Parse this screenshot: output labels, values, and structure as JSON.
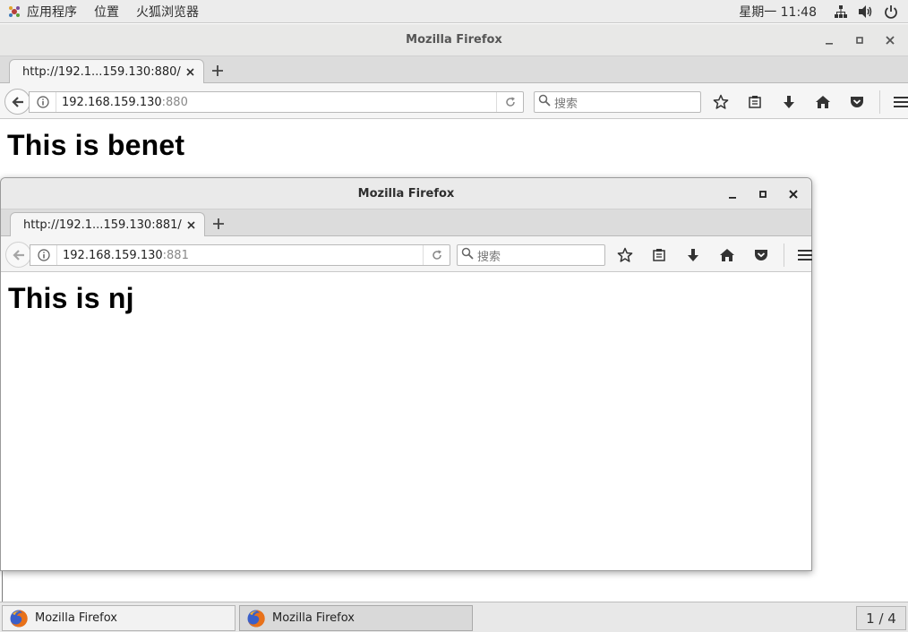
{
  "topbar": {
    "apps_label": "应用程序",
    "places_label": "位置",
    "firefox_label": "火狐浏览器",
    "clock": "星期一 11:48"
  },
  "back_window": {
    "title": "Mozilla Firefox",
    "tab_label": "http://192.1...159.130:880/",
    "url_host": "192.168.159.130",
    "url_port": ":880",
    "search_placeholder": "搜索",
    "heading": "This is benet"
  },
  "front_window": {
    "title": "Mozilla Firefox",
    "tab_label": "http://192.1...159.130:881/",
    "url_host": "192.168.159.130",
    "url_port": ":881",
    "search_placeholder": "搜索",
    "heading": "This is nj"
  },
  "taskbar": {
    "items": [
      {
        "label": "Mozilla Firefox"
      },
      {
        "label": "Mozilla Firefox"
      }
    ],
    "workspace": "1 / 4"
  },
  "icons": {
    "star": "bookmark-star-icon",
    "library": "reading-list-icon",
    "download": "download-arrow-icon",
    "home": "home-icon",
    "pocket": "pocket-icon",
    "menu": "hamburger-menu-icon"
  }
}
